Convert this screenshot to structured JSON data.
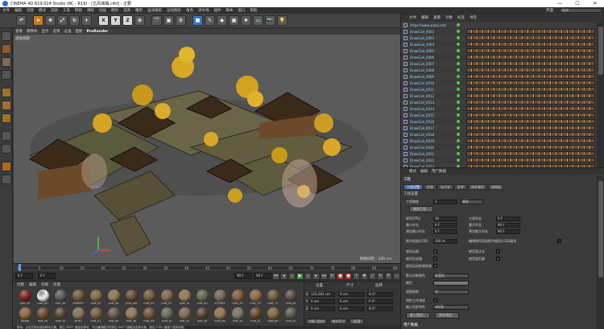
{
  "window": {
    "title": "CINEMA 4D R19.024 Studio (RC - R19) - [古风城镇.c4d] - 主要",
    "controls": [
      "—",
      "☐",
      "✕"
    ]
  },
  "menu": [
    "文件",
    "编辑",
    "创建",
    "模式",
    "选择",
    "工具",
    "网格",
    "捕捉",
    "动画",
    "模拟",
    "渲染",
    "雕刻",
    "运动跟踪",
    "运动图形",
    "角色",
    "流水线",
    "插件",
    "脚本",
    "窗口",
    "帮助"
  ],
  "right_menu": {
    "label": "界面",
    "layout": "启动"
  },
  "toolbar": {
    "undo_icon": "undo-icon",
    "axis": [
      "X",
      "Y",
      "Z"
    ]
  },
  "viewport": {
    "menu": [
      "查看",
      "摄像机",
      "显示",
      "选项",
      "过滤",
      "面板"
    ],
    "renderer": "ProRender",
    "title": "透视视图",
    "distance": "网格间距：100 cm"
  },
  "timeline": {
    "ticks": [
      "0",
      "5",
      "10",
      "15",
      "20",
      "25",
      "30",
      "35",
      "40",
      "45",
      "50",
      "55",
      "60",
      "65",
      "70",
      "75",
      "80",
      "85",
      "90"
    ],
    "start_frame": "0 F",
    "current_frame": "0 F",
    "end_frame": "90 F",
    "max_frame": "90 F"
  },
  "materials": {
    "tabs": [
      "创建",
      "编辑",
      "功能",
      "纹理"
    ],
    "items": [
      {
        "label": "mat_re",
        "color": "#8a1e1e"
      },
      {
        "label": "mat_b0",
        "color": "#f0f0f0"
      },
      {
        "label": "mat_se",
        "color": "#5a5a5a"
      },
      {
        "label": "a0a993",
        "color": "#7a5a3a"
      },
      {
        "label": "mat_b7",
        "color": "#8b6a44"
      },
      {
        "label": "mat_be",
        "color": "#9a7b52"
      },
      {
        "label": "mat_wo",
        "color": "#6b4a2e"
      },
      {
        "label": "mat_05",
        "color": "#7b5b39"
      },
      {
        "label": "mat_01",
        "color": "#8a6a44"
      },
      {
        "label": "mat_ro",
        "color": "#a37f55"
      },
      {
        "label": "mat_bu",
        "color": "#6a6a4a"
      },
      {
        "label": "e37b94",
        "color": "#7a6a52"
      },
      {
        "label": "mat_54",
        "color": "#8c5e3a"
      },
      {
        "label": "mat_20",
        "color": "#9a6a44"
      },
      {
        "label": "mat_27",
        "color": "#7a5a3a"
      },
      {
        "label": "mat_bl",
        "color": "#5a4a3a"
      },
      {
        "label": "5dsbe",
        "color": "#9a6b3a"
      },
      {
        "label": "mat_wi",
        "color": "#6e4e30"
      },
      {
        "label": "mat_bl",
        "color": "#5c4630"
      },
      {
        "label": "aerf0",
        "color": "#8a7a5a"
      },
      {
        "label": "mat_01",
        "color": "#7d5d3d"
      },
      {
        "label": "mat_sh",
        "color": "#6a5a4a"
      },
      {
        "label": "mat_ze",
        "color": "#9b7b5a"
      },
      {
        "label": "mat_06",
        "color": "#7a5234"
      },
      {
        "label": "mat_st",
        "color": "#6e6e5e"
      },
      {
        "label": "mat_sv",
        "color": "#8a6e4e"
      },
      {
        "label": "mat_bt",
        "color": "#5e3e2e"
      },
      {
        "label": "mat_ws",
        "color": "#9d7a4a"
      },
      {
        "label": "mat_se",
        "color": "#7a7a6a"
      },
      {
        "label": "mat_0l",
        "color": "#6a4a2a"
      },
      {
        "label": "mat_be",
        "color": "#8a6a3a"
      },
      {
        "label": "mat_sl",
        "color": "#5a5a4a"
      }
    ]
  },
  "coordinates": {
    "headers": [
      "位置",
      "尺寸",
      "旋转"
    ],
    "rows": [
      {
        "axis": "X",
        "pos": "121.281 cm",
        "size": "0 cm",
        "rot": "H 0°"
      },
      {
        "axis": "Y",
        "pos": "0 cm",
        "size": "0 cm",
        "rot": "P 0°"
      },
      {
        "axis": "Z",
        "pos": "0 cm",
        "size": "0 cm",
        "rot": "B 0°"
      }
    ],
    "mode": "对象 (相对)",
    "size_mode": "绝对尺寸",
    "apply": "应用"
  },
  "status": "移动：点击并拖动鼠标移动元素。按住 SHIFT 键量化移动；节点编辑模式时按住 SHIFT 键增加选择对象；按住 CTRL 键减少选择对象。",
  "objects": {
    "tabs": [
      "文件",
      "编辑",
      "查看",
      "对象",
      "标签",
      "书签"
    ],
    "items": [
      "https://www.aiaiai.net/",
      "DrawCall_0002",
      "DrawCall_0003",
      "DrawCall_0004",
      "DrawCall_0005",
      "DrawCall_0006",
      "DrawCall_0007",
      "DrawCall_0008",
      "DrawCall_0009",
      "DrawCall_0010",
      "DrawCall_0011",
      "DrawCall_0012",
      "DrawCall_0013",
      "DrawCall_0014",
      "DrawCall_0015",
      "DrawCall_0016",
      "DrawCall_0017",
      "DrawCall_0018",
      "DrawCall_0019",
      "DrawCall_0020",
      "DrawCall_0021",
      "DrawCall_0022",
      "DrawCall_0023"
    ]
  },
  "attributes": {
    "menu": [
      "模式",
      "编辑",
      "用户数据"
    ],
    "header": "工程",
    "tabs": [
      "工程设置",
      "信息",
      "动力学",
      "参考",
      "待办事项",
      "帧插值"
    ],
    "section": "工程设置",
    "scale_label": "工程缩放",
    "scale_value": "1",
    "scale_unit": "厘米",
    "scale_button": "缩放工程...",
    "fps_label": "帧率(FPS)",
    "fps": "30",
    "min_label": "最小时长",
    "min": "0 F",
    "preview_min_label": "预览最小时长",
    "preview_min": "0 F",
    "lod_label": "细节程度(LOD)",
    "lod": "100 %",
    "project_time_label": "工程时长",
    "project_time": "0 F",
    "max_label": "最大时长",
    "max": "90 F",
    "preview_max_label": "预览最大时长",
    "preview_max": "90 F",
    "render_lod_label": "编辑使用渲染细节级别(LOD)级别",
    "anim_label": "使用动画",
    "expr_label": "使用表达式",
    "gen_label": "使用生成器",
    "deform_label": "使用变形器",
    "motion_label": "使用运动剪辑系统",
    "default_color_label": "默认对象颜色",
    "default_color": "灰蓝色",
    "color_label": "颜色",
    "view_clip_label": "视图修剪",
    "view_clip": "中",
    "linear_label": "线性工作流程",
    "input_color_label": "输入色彩特性",
    "input_color": "sRGB",
    "load_button": "载入预设...",
    "save_button": "保存预设...",
    "footer": "用户数据"
  }
}
